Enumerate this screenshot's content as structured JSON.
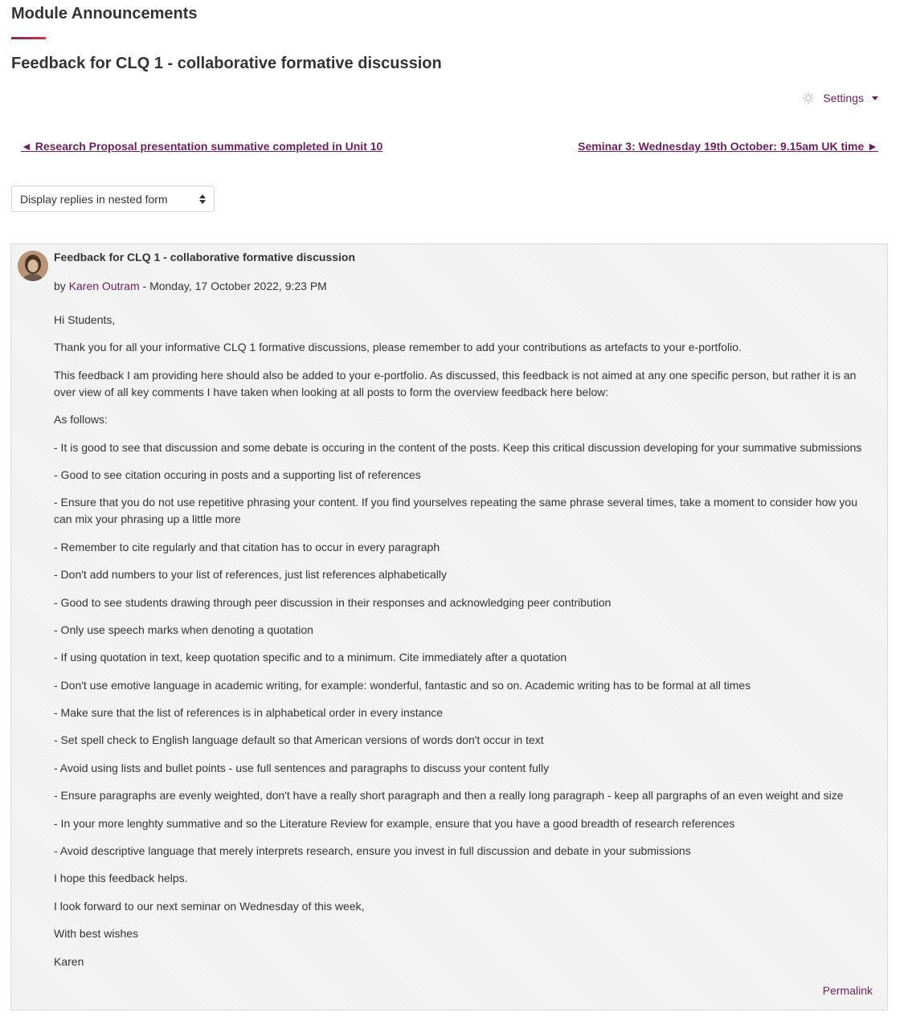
{
  "header": {
    "page_title": "Module Announcements",
    "discussion_title": "Feedback for CLQ 1 - collaborative formative discussion"
  },
  "settings": {
    "label": "Settings",
    "icon": "gear-icon"
  },
  "navigation": {
    "prev": "◄ Research Proposal presentation summative completed in Unit 10",
    "next": "Seminar 3: Wednesday 19th October: 9.15am UK time ►"
  },
  "display_mode": {
    "selected": "Display replies in nested form"
  },
  "post": {
    "subject": "Feedback for CLQ 1 - collaborative formative discussion",
    "by": "by",
    "author": "Karen Outram",
    "date": "- Monday, 17 October 2022, 9:23 PM",
    "paragraphs": [
      "Hi Students,",
      "Thank you for all your informative CLQ 1 formative discussions, please remember to add your contributions as artefacts to your e-portfolio.",
      "This feedback I am providing here should also be added to your e-portfolio. As discussed, this feedback is not aimed at any one specific person, but rather it is an over view of all key comments I have taken when looking at all posts to form the overview feedback here below:",
      "As follows:",
      "- It is good to see that discussion and some debate is occuring in the content of the posts. Keep this critical discussion developing for your summative submissions",
      "- Good to see citation occuring in posts and a supporting list of references",
      "- Ensure that you do not use repetitive phrasing your content. If you find yourselves repeating the same phrase several times, take a moment to consider how you can mix your phrasing up a little more",
      "- Remember to cite regularly and that citation has to occur in every paragraph",
      "- Don't add numbers to your list of references, just list references alphabetically",
      "- Good to see students drawing through peer discussion in their responses and acknowledging peer contribution",
      "- Only use speech marks when denoting a quotation",
      "- If using quotation in text, keep quotation specific and to a minimum. Cite immediately after a quotation",
      "- Don't use emotive language in academic writing, for example: wonderful, fantastic and so on. Academic writing has to be formal at all times",
      "- Make sure that the list of references is in alphabetical order in every instance",
      "- Set spell check to English language default so that American versions of words don't occur in text",
      "- Avoid using lists and bullet points - use full sentences and paragraphs to discuss your content fully",
      "- Ensure paragraphs are evenly weighted, don't have a really short paragraph and then a really long paragraph - keep all pargraphs of an even weight and size",
      "- In your more lenghty summative and so the Literature Review for example, ensure that you have a good breadth of research references",
      "- Avoid descriptive language that merely interprets research, ensure you invest in full discussion and debate in your submissions",
      "I hope this feedback helps.",
      "I look forward to our next seminar on Wednesday of this week,",
      "With best wishes",
      "Karen"
    ],
    "permalink": "Permalink"
  },
  "colors": {
    "link": "#6b1f5c",
    "text": "#333333",
    "post_background": "#f4f4f4"
  }
}
